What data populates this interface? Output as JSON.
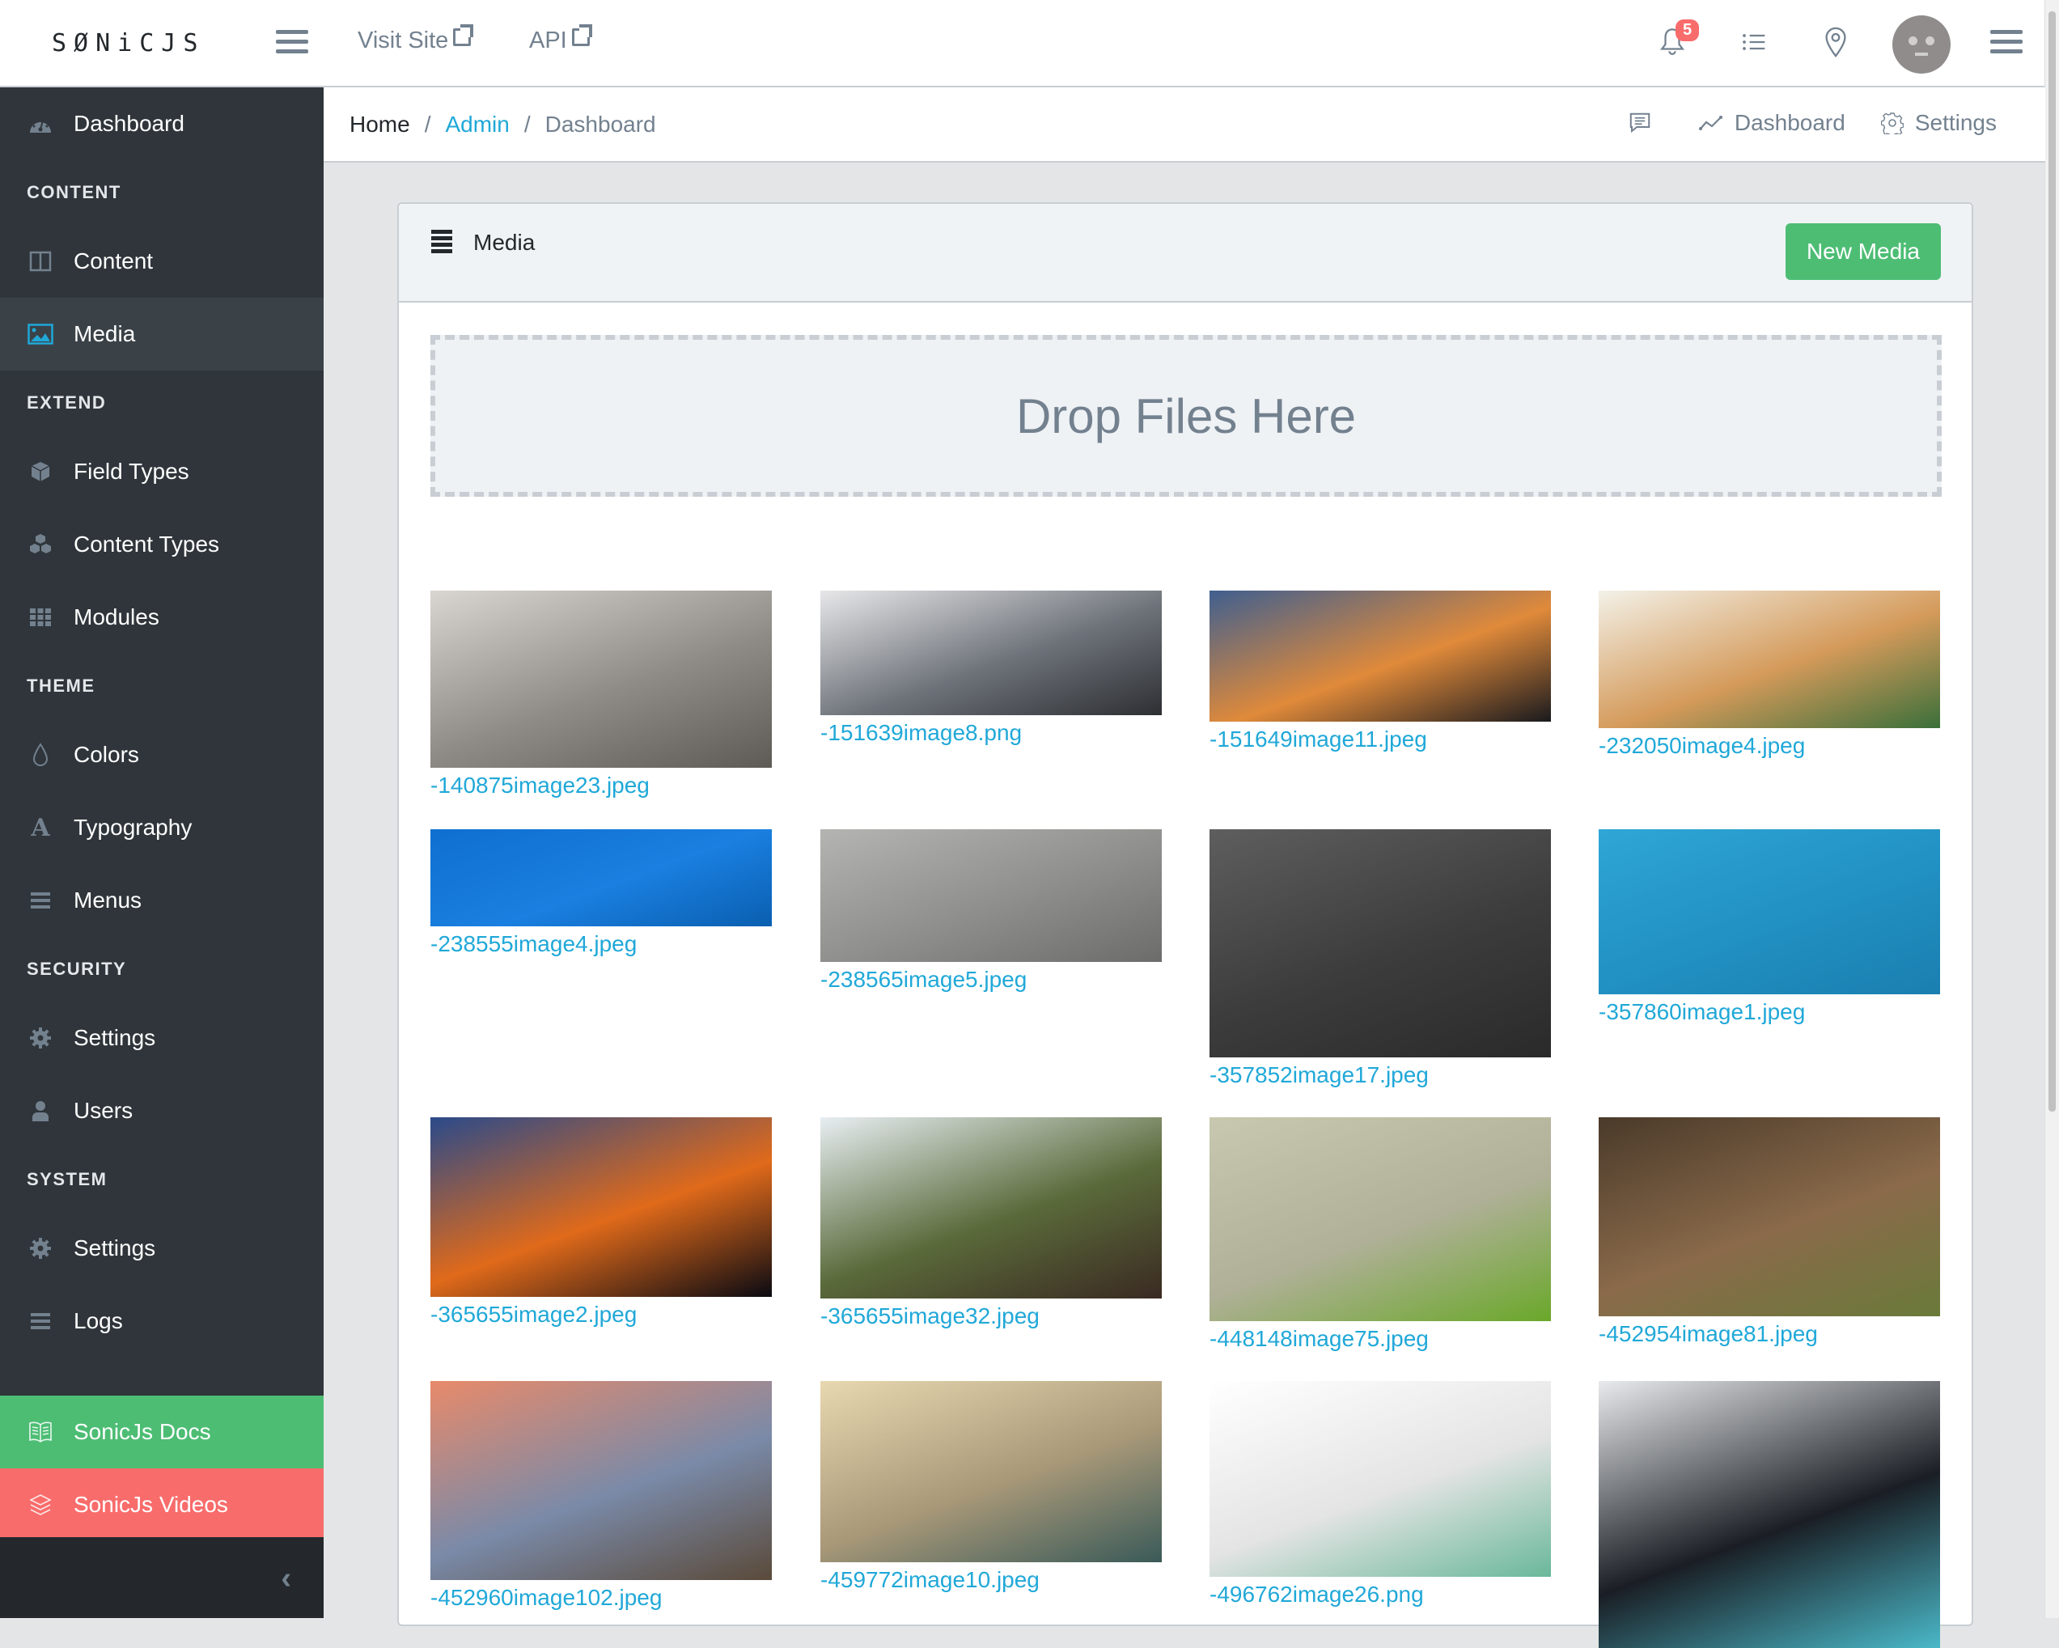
{
  "header": {
    "brand": "SØNiCJS",
    "nav_links": [
      {
        "label": "Visit Site",
        "icon": "external-link-icon"
      },
      {
        "label": "API",
        "icon": "external-link-icon"
      }
    ],
    "notification_count": "5",
    "icons": [
      "bell-icon",
      "list-icon",
      "location-pin-icon",
      "avatar",
      "menu-icon"
    ]
  },
  "sidebar": {
    "sections": [
      {
        "items": [
          {
            "label": "Dashboard",
            "icon": "dashboard-gauge-icon"
          }
        ]
      },
      {
        "title": "CONTENT",
        "items": [
          {
            "label": "Content",
            "icon": "columns-icon"
          },
          {
            "label": "Media",
            "icon": "image-icon",
            "active": true
          }
        ]
      },
      {
        "title": "EXTEND",
        "items": [
          {
            "label": "Field Types",
            "icon": "cube-icon"
          },
          {
            "label": "Content Types",
            "icon": "cubes-icon"
          },
          {
            "label": "Modules",
            "icon": "grid-icon"
          }
        ]
      },
      {
        "title": "THEME",
        "items": [
          {
            "label": "Colors",
            "icon": "drop-icon"
          },
          {
            "label": "Typography",
            "icon": "font-icon"
          },
          {
            "label": "Menus",
            "icon": "bars-icon"
          }
        ]
      },
      {
        "title": "SECURITY",
        "items": [
          {
            "label": "Settings",
            "icon": "gear-icon"
          },
          {
            "label": "Users",
            "icon": "user-icon"
          }
        ]
      },
      {
        "title": "SYSTEM",
        "items": [
          {
            "label": "Settings",
            "icon": "gear-icon"
          },
          {
            "label": "Logs",
            "icon": "bars-icon"
          }
        ]
      }
    ],
    "docs_label": "SonicJs Docs",
    "videos_label": "SonicJs Videos",
    "colors": {
      "docs": "#4dbd74",
      "videos": "#f86c6b",
      "bg": "#2f353a"
    }
  },
  "breadcrumb": {
    "home": "Home",
    "admin": "Admin",
    "current": "Dashboard",
    "actions": [
      {
        "label": "",
        "icon": "comment-icon"
      },
      {
        "label": "Dashboard",
        "icon": "graph-icon"
      },
      {
        "label": "Settings",
        "icon": "settings-icon"
      }
    ]
  },
  "card": {
    "title": "Media",
    "new_button": "New Media",
    "dropzone": "Drop Files Here"
  },
  "media": [
    {
      "name": "-140875image23.jpeg",
      "colors": [
        "#d9d6d2",
        "#8f8b86",
        "#5e5a55"
      ]
    },
    {
      "name": "-151639image8.png",
      "colors": [
        "#e7e7e9",
        "#6e737a",
        "#2d2f33"
      ]
    },
    {
      "name": "-151649image11.jpeg",
      "colors": [
        "#3f5f8f",
        "#e08a3a",
        "#1a1a1e"
      ]
    },
    {
      "name": "-232050image4.jpeg",
      "colors": [
        "#f3f1e8",
        "#d49a5a",
        "#3a6f3a"
      ]
    },
    {
      "name": "-238555image4.jpeg",
      "colors": [
        "#0f6fd0",
        "#1a7fe0",
        "#0a5fb0"
      ]
    },
    {
      "name": "-238565image5.jpeg",
      "colors": [
        "#b4b4b2",
        "#8e8e8c",
        "#6c6c6a"
      ]
    },
    {
      "name": "-357852image17.jpeg",
      "colors": [
        "#5e5e5e",
        "#3c3c3c",
        "#2a2a2a"
      ]
    },
    {
      "name": "-357860image1.jpeg",
      "colors": [
        "#2ea6d6",
        "#2190c2",
        "#1a7fb0"
      ]
    },
    {
      "name": "-365655image2.jpeg",
      "colors": [
        "#2a4a8a",
        "#e06a1a",
        "#0a0a12"
      ]
    },
    {
      "name": "-365655image32.jpeg",
      "colors": [
        "#e8eef2",
        "#5a6a3a",
        "#3a2a22"
      ]
    },
    {
      "name": "-448148image75.jpeg",
      "colors": [
        "#c8c8b0",
        "#b0b098",
        "#6aa82a"
      ]
    },
    {
      "name": "-452954image81.jpeg",
      "colors": [
        "#4a3a2a",
        "#8a6a4a",
        "#6a7a3a"
      ]
    },
    {
      "name": "-452960image102.jpeg",
      "colors": [
        "#e88a6a",
        "#7a8aa8",
        "#5a4a3a"
      ]
    },
    {
      "name": "-459772image10.jpeg",
      "colors": [
        "#e8d8b0",
        "#a89878",
        "#3a5a58"
      ]
    },
    {
      "name": "-496762image26.png",
      "colors": [
        "#ffffff",
        "#e4e4e4",
        "#6ab89a"
      ]
    },
    {
      "name": "",
      "colors": [
        "#e8eaec",
        "#1a1e24",
        "#4ab8c8"
      ]
    }
  ]
}
